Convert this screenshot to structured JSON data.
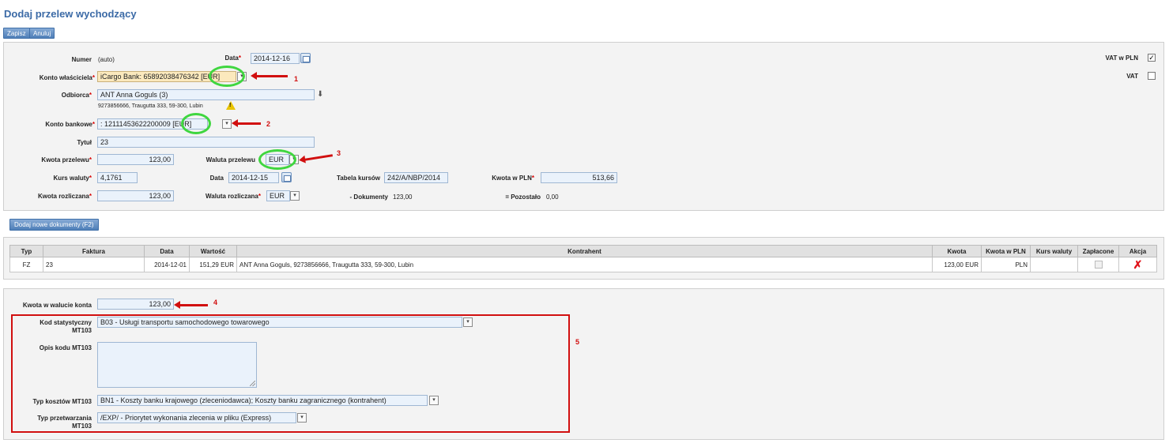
{
  "title": "Dodaj przelew wychodzący",
  "toolbar": {
    "save": "Zapisz",
    "cancel": "Anuluj"
  },
  "form": {
    "numer_label": "Numer",
    "numer_value": "(auto)",
    "data_label": "Data",
    "data_value": "2014-12-16",
    "vat_pln_label": "VAT w PLN",
    "vat_pln_checked": "✓",
    "vat_label": "VAT",
    "konto_wl_label": "Konto właściciela",
    "konto_wl_value": "iCargo Bank: 65892038476342 [EUR]",
    "odbiorca_label": "Odbiorca",
    "odbiorca_value": "ANT Anna Goguls (3)",
    "odbiorca_address": "9273856666, Traugutta 333, 59-300, Lubin",
    "konto_bank_label": "Konto bankowe",
    "konto_bank_value": ": 12111453622200009 [EUR]",
    "tytul_label": "Tytuł",
    "tytul_value": "23",
    "kwota_przelewu_label": "Kwota przelewu",
    "kwota_przelewu_value": "123,00",
    "waluta_przelewu_label": "Waluta przelewu",
    "waluta_przelewu_value": "EUR",
    "kurs_label": "Kurs waluty",
    "kurs_value": "4,1761",
    "data2_label": "Data",
    "data2_value": "2014-12-15",
    "tabela_label": "Tabela kursów",
    "tabela_value": "242/A/NBP/2014",
    "kwota_pln_label": "Kwota w PLN",
    "kwota_pln_value": "513,66",
    "kwota_rozl_label": "Kwota rozliczana",
    "kwota_rozl_value": "123,00",
    "waluta_rozl_label": "Waluta rozliczana",
    "waluta_rozl_value": "EUR",
    "dokumenty_label": "- Dokumenty",
    "dokumenty_value": "123,00",
    "pozostalo_label": "= Pozostało",
    "pozostalo_value": "0,00"
  },
  "add_docs_button": "Dodaj nowe dokumenty (F2)",
  "table": {
    "headers": [
      "Typ",
      "Faktura",
      "Data",
      "Wartość",
      "Kontrahent",
      "Kwota",
      "Kwota w PLN",
      "Kurs waluty",
      "Zapłacone",
      "Akcja"
    ],
    "rows": [
      {
        "typ": "FZ",
        "faktura": "23",
        "data": "2014-12-01",
        "wartosc": "151,29 EUR",
        "kontrahent": "ANT Anna Goguls, 9273856666, Traugutta 333, 59-300, Lubin",
        "kwota": "123,00 EUR",
        "kwota_pln": "PLN",
        "kurs": "",
        "akcja": "✗"
      }
    ]
  },
  "mt103": {
    "kwota_konta_label": "Kwota w walucie konta",
    "kwota_konta_value": "123,00",
    "kod_label": "Kod statystyczny MT103",
    "kod_value": "B03 - Usługi transportu samochodowego towarowego",
    "opis_label": "Opis kodu MT103",
    "opis_value": "",
    "typ_kosztow_label": "Typ kosztów MT103",
    "typ_kosztow_value": "BN1 - Koszty banku krajowego (zleceniodawca); Koszty banku zagranicznego (kontrahent)",
    "typ_przetw_label": "Typ przetwarzania MT103",
    "typ_przetw_value": "/EXP/ - Priorytet wykonania zlecenia w pliku (Express)"
  },
  "annotations": {
    "n1": "1",
    "n2": "2",
    "n3": "3",
    "n4": "4",
    "n5": "5"
  },
  "icons": {
    "dropdown": "▾",
    "download": "⬇",
    "warning": "!"
  },
  "colors": {
    "title": "#3b6aa6",
    "highlight_ring": "#3fd63f",
    "annotation_red": "#d10f0f"
  }
}
